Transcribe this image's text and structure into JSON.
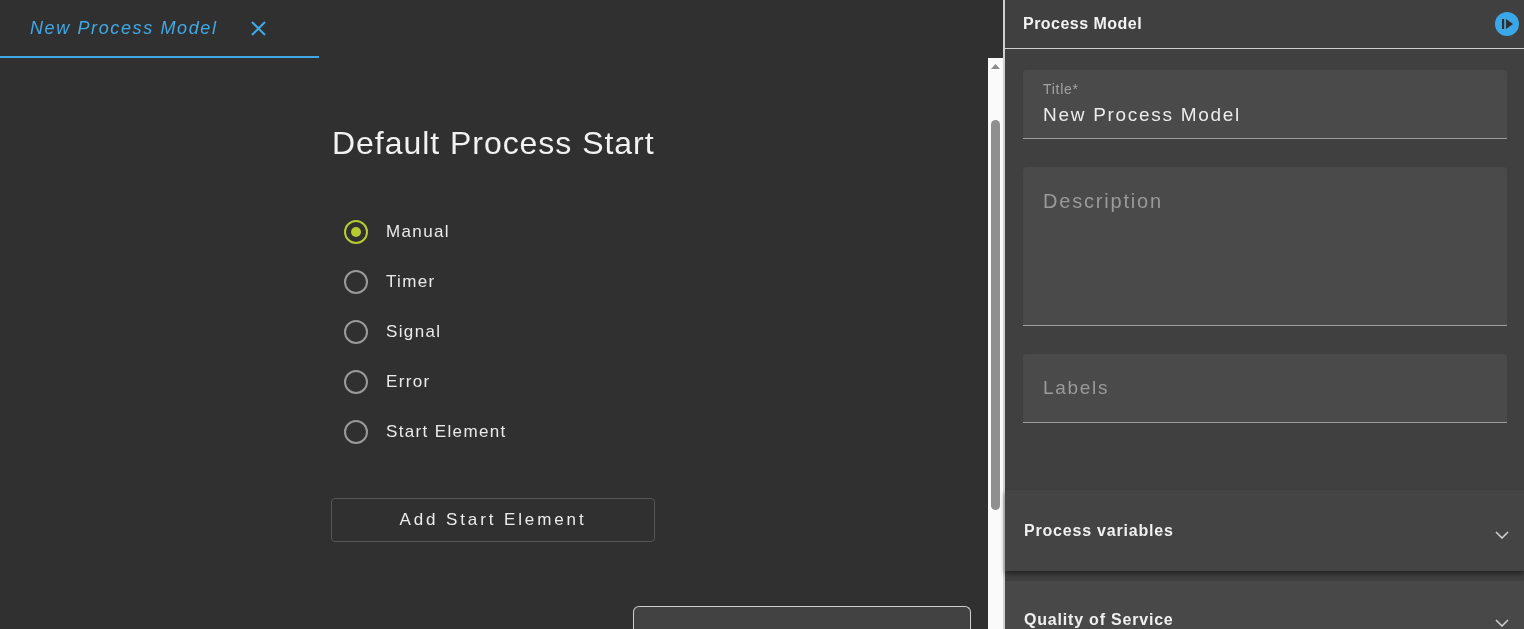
{
  "tab": {
    "label": "New Process Model",
    "selected": true
  },
  "start_section": {
    "heading": "Default Process Start",
    "options": [
      {
        "label": "Manual",
        "selected": true
      },
      {
        "label": "Timer",
        "selected": false
      },
      {
        "label": "Signal",
        "selected": false
      },
      {
        "label": "Error",
        "selected": false
      },
      {
        "label": "Start Element",
        "selected": false
      }
    ],
    "add_button": "Add Start Element"
  },
  "side_panel": {
    "title": "Process Model",
    "fields": [
      {
        "kind": "text",
        "label": "Title*",
        "value": "New Process Model"
      },
      {
        "kind": "textarea",
        "placeholder": "Description"
      },
      {
        "kind": "text",
        "placeholder": "Labels"
      }
    ],
    "sections": [
      {
        "title": "Process variables",
        "expanded": false
      },
      {
        "title": "Quality of Service",
        "expanded": false
      }
    ]
  }
}
